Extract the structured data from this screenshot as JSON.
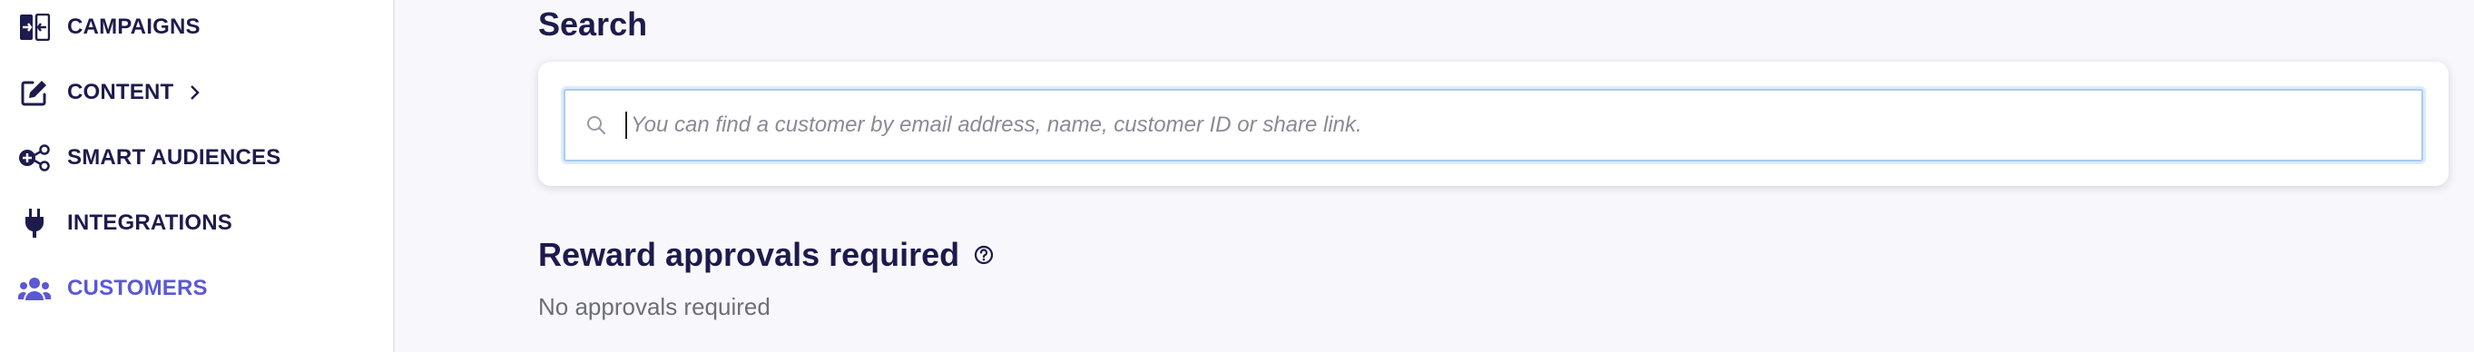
{
  "sidebar": {
    "items": [
      {
        "label": "CAMPAIGNS",
        "icon": "campaigns-icon"
      },
      {
        "label": "CONTENT",
        "icon": "edit-icon",
        "has_submenu": true
      },
      {
        "label": "SMART AUDIENCES",
        "icon": "audiences-icon"
      },
      {
        "label": "INTEGRATIONS",
        "icon": "plug-icon"
      },
      {
        "label": "CUSTOMERS",
        "icon": "customers-icon",
        "active": true
      }
    ]
  },
  "main": {
    "search_title": "Search",
    "search_placeholder": "You can find a customer by email address, name, customer ID or share link.",
    "search_value": "",
    "rewards_title": "Reward approvals required",
    "rewards_empty": "No approvals required"
  },
  "colors": {
    "text_dark": "#1d1b4c",
    "active_accent": "#5a58d6",
    "background": "#f8f8fc",
    "focus_border": "#a9ccef"
  }
}
